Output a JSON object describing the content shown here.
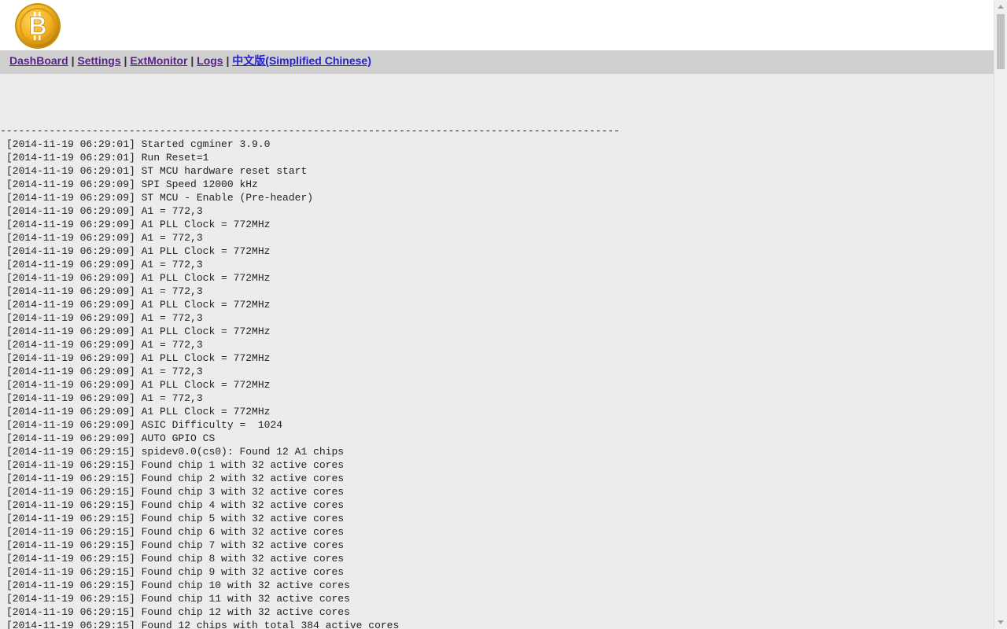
{
  "nav": {
    "items": [
      {
        "label": "DashBoard"
      },
      {
        "label": "Settings"
      },
      {
        "label": "ExtMonitor"
      },
      {
        "label": "Logs"
      },
      {
        "label": "中文版(Simplified Chinese)"
      }
    ],
    "separator": "|"
  },
  "log": {
    "divider": "-----------------------------------------------------------------------------------------------------",
    "lines": [
      "[2014-11-19 06:29:01] Started cgminer 3.9.0",
      "[2014-11-19 06:29:01] Run Reset=1",
      "[2014-11-19 06:29:01] ST MCU hardware reset start",
      "[2014-11-19 06:29:09] SPI Speed 12000 kHz",
      "[2014-11-19 06:29:09] ST MCU - Enable (Pre-header)",
      "[2014-11-19 06:29:09] A1 = 772,3",
      "[2014-11-19 06:29:09] A1 PLL Clock = 772MHz",
      "[2014-11-19 06:29:09] A1 = 772,3",
      "[2014-11-19 06:29:09] A1 PLL Clock = 772MHz",
      "[2014-11-19 06:29:09] A1 = 772,3",
      "[2014-11-19 06:29:09] A1 PLL Clock = 772MHz",
      "[2014-11-19 06:29:09] A1 = 772,3",
      "[2014-11-19 06:29:09] A1 PLL Clock = 772MHz",
      "[2014-11-19 06:29:09] A1 = 772,3",
      "[2014-11-19 06:29:09] A1 PLL Clock = 772MHz",
      "[2014-11-19 06:29:09] A1 = 772,3",
      "[2014-11-19 06:29:09] A1 PLL Clock = 772MHz",
      "[2014-11-19 06:29:09] A1 = 772,3",
      "[2014-11-19 06:29:09] A1 PLL Clock = 772MHz",
      "[2014-11-19 06:29:09] A1 = 772,3",
      "[2014-11-19 06:29:09] A1 PLL Clock = 772MHz",
      "[2014-11-19 06:29:09] ASIC Difficulty =  1024",
      "[2014-11-19 06:29:09] AUTO GPIO CS",
      "[2014-11-19 06:29:15] spidev0.0(cs0): Found 12 A1 chips",
      "[2014-11-19 06:29:15] Found chip 1 with 32 active cores",
      "[2014-11-19 06:29:15] Found chip 2 with 32 active cores",
      "[2014-11-19 06:29:15] Found chip 3 with 32 active cores",
      "[2014-11-19 06:29:15] Found chip 4 with 32 active cores",
      "[2014-11-19 06:29:15] Found chip 5 with 32 active cores",
      "[2014-11-19 06:29:15] Found chip 6 with 32 active cores",
      "[2014-11-19 06:29:15] Found chip 7 with 32 active cores",
      "[2014-11-19 06:29:15] Found chip 8 with 32 active cores",
      "[2014-11-19 06:29:15] Found chip 9 with 32 active cores",
      "[2014-11-19 06:29:15] Found chip 10 with 32 active cores",
      "[2014-11-19 06:29:15] Found chip 11 with 32 active cores",
      "[2014-11-19 06:29:15] Found chip 12 with 32 active cores",
      "[2014-11-19 06:29:15] Found 12 chips with total 384 active cores"
    ]
  },
  "colors": {
    "nav_link": "#5a1f8f",
    "nav_link_chinese": "#2222cc",
    "nav_bg": "#cfcfcf",
    "page_bg": "#ececec",
    "logo_gold": "#f2b01e"
  },
  "icons": {
    "logo": "bitcoin-logo-icon"
  }
}
